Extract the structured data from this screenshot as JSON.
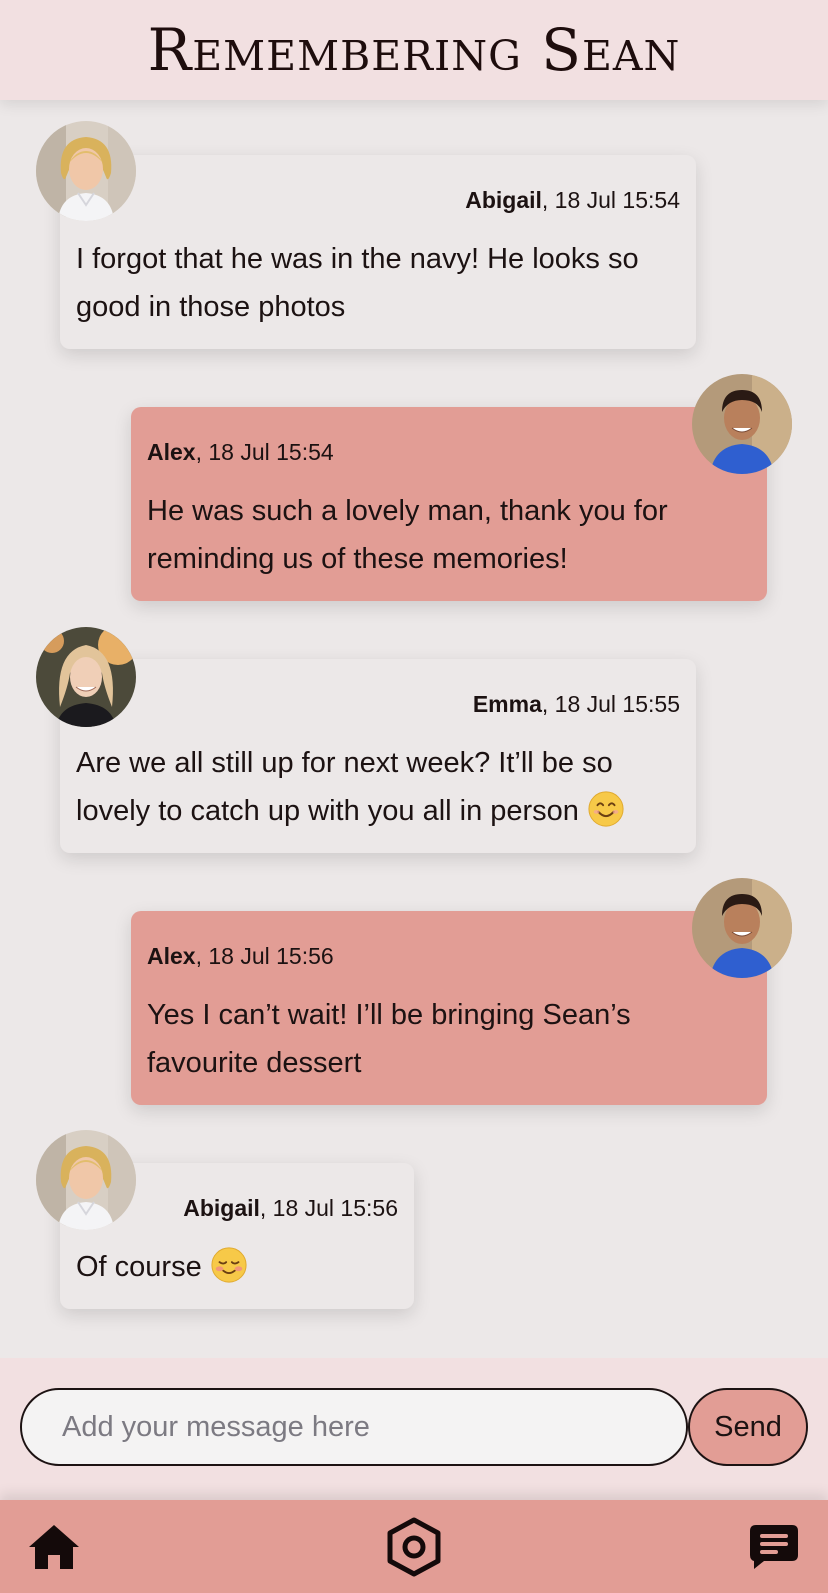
{
  "header": {
    "title": "Remembering Sean"
  },
  "messages": [
    {
      "author": "Abigail",
      "time": ", 18 Jul 15:54",
      "text": "I forgot that he was in the navy! He looks so good in those photos"
    },
    {
      "author": "Alex",
      "time": ", 18 Jul 15:54",
      "text": "He was such a lovely man, thank you for reminding us of these memories!"
    },
    {
      "author": "Emma",
      "time": ", 18 Jul 15:55",
      "text": "Are we all still up for next week? It’ll be so lovely to catch up with you all in person",
      "emoji": "smiling-face-emoji"
    },
    {
      "author": "Alex",
      "time": ", 18 Jul 15:56",
      "text": "Yes I can’t wait! I’ll be bringing Sean’s favourite dessert"
    },
    {
      "author": "Abigail",
      "time": ", 18 Jul 15:56",
      "text": "Of course",
      "emoji": "blushing-smile-emoji"
    }
  ],
  "composer": {
    "placeholder": "Add your message here",
    "value": "",
    "send_label": "Send"
  },
  "nav": {
    "items": [
      {
        "icon": "home-icon"
      },
      {
        "icon": "hexagon-logo-icon"
      },
      {
        "icon": "chat-icon"
      }
    ]
  },
  "colors": {
    "header_bg": "#f2e0e1",
    "page_bg": "#ece8e8",
    "accent": "#e29d95",
    "text": "#1c1212"
  }
}
